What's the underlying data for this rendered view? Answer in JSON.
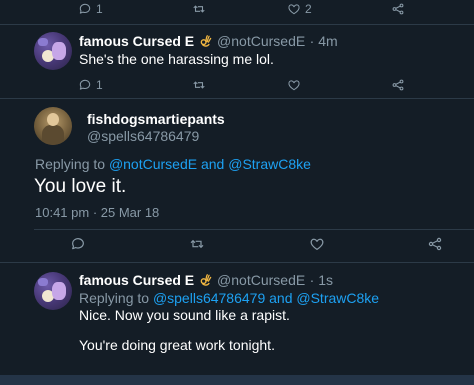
{
  "top_actions": {
    "reply_count": "1",
    "like_count": "2"
  },
  "tweet1": {
    "author_name": "famous Cursed E",
    "author_handle": "@notCursedE",
    "time": "· 4m",
    "text": "She's the one harassing me lol.",
    "reply_count": "1"
  },
  "tweet2": {
    "author_name": "fishdogsmartiepants",
    "author_handle": "@spells64786479",
    "replying_label": "Replying to",
    "reply_to_1": "@notCursedE",
    "and_word": "and",
    "reply_to_2": "@StrawC8ke",
    "text": "You love it.",
    "timestamp": "10:41 pm · 25 Mar 18"
  },
  "tweet3": {
    "author_name": "famous Cursed E",
    "author_handle": "@notCursedE",
    "time": "· 1s",
    "replying_label": "Replying to",
    "reply_to_1": "@spells64786479",
    "and_word": "and",
    "reply_to_2": "@StrawC8ke",
    "line1": "Nice. Now you sound like a rapist.",
    "line2": "You're doing great work tonight."
  },
  "icons": {
    "reply": "reply-icon",
    "retweet": "retweet-icon",
    "like": "heart-icon",
    "share": "share-icon",
    "emoji": "ok-hand-icon"
  },
  "colors": {
    "background": "#141d26",
    "link": "#1da1f2",
    "muted": "#8899a6",
    "divider": "#2c3a47"
  }
}
